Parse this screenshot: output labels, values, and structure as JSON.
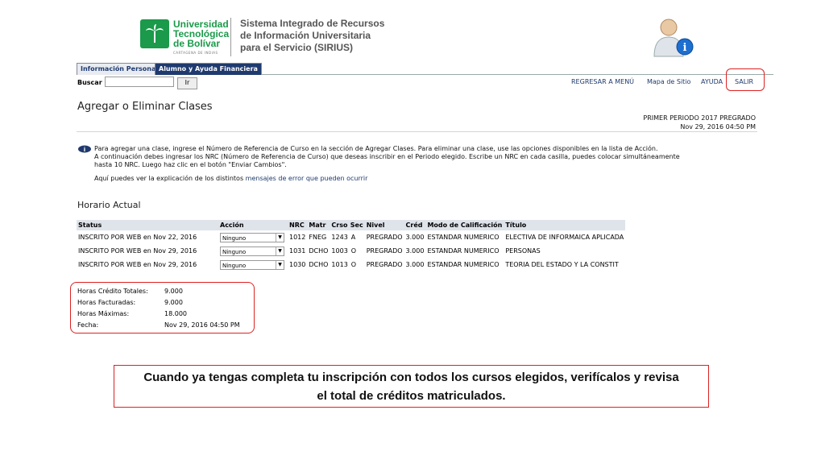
{
  "header": {
    "logo_lines": [
      "Universidad",
      "Tecnológica",
      "de Bolívar"
    ],
    "logo_sub": "CARTAGENA DE INDIAS",
    "system_title_lines": [
      "Sistema Integrado de Recursos",
      "de Información Universitaria",
      "para el Servicio (SIRIUS)"
    ]
  },
  "tabs": [
    {
      "label": "Información Personal"
    },
    {
      "label": "Alumno y Ayuda Financiera"
    }
  ],
  "search": {
    "label": "Buscar",
    "value": "",
    "button": "Ir"
  },
  "toplinks": {
    "menu": "REGRESAR A MENÚ",
    "sitemap": "Mapa de Sitio",
    "help": "AYUDA",
    "exit": "SALIR"
  },
  "page": {
    "title": "Agregar o Eliminar Clases",
    "term": "PRIMER PERIODO 2017 PREGRADO",
    "datetime": "Nov 29, 2016 04:50 PM"
  },
  "info": {
    "line1": "Para agregar una clase, ingrese el Número de Referencia de Curso en la sección de Agregar Clases. Para eliminar una clase, use las opciones disponibles en la lista de Acción.",
    "line2": "A continuación debes ingresar los NRC (Número de Referencia de Curso) que deseas inscribir en el Periodo elegido. Escribe un NRC en cada casilla, puedes colocar simultáneamente",
    "line3": "hasta 10 NRC. Luego haz clic en el botón \"Enviar Cambios\".",
    "explain_prefix": "Aquí puedes ver la explicación de los distintos",
    "explain_link": "mensajes de error que pueden ocurrir"
  },
  "schedule": {
    "title": "Horario Actual",
    "headers": [
      "Status",
      "Acción",
      "NRC",
      "Matr",
      "Crso",
      "Sec",
      "Nivel",
      "Créd",
      "Modo de Calificación",
      "Título"
    ],
    "rows": [
      {
        "status": "INSCRITO POR WEB en Nov 22, 2016",
        "action": "Ninguno",
        "nrc": "1012",
        "matr": "FNEG",
        "crso": "1243",
        "sec": "A",
        "nivel": "PREGRADO",
        "cred": "3.000",
        "modo": "ESTANDAR NUMERICO",
        "titulo": "ELECTIVA DE INFORMAICA APLICADA"
      },
      {
        "status": "INSCRITO POR WEB en Nov 29, 2016",
        "action": "Ninguno",
        "nrc": "1031",
        "matr": "DCHO",
        "crso": "1003",
        "sec": "O",
        "nivel": "PREGRADO",
        "cred": "3.000",
        "modo": "ESTANDAR NUMERICO",
        "titulo": "PERSONAS"
      },
      {
        "status": "INSCRITO POR WEB en Nov 29, 2016",
        "action": "Ninguno",
        "nrc": "1030",
        "matr": "DCHO",
        "crso": "1013",
        "sec": "O",
        "nivel": "PREGRADO",
        "cred": "3.000",
        "modo": "ESTANDAR NUMERICO",
        "titulo": "TEORIA DEL ESTADO Y LA CONSTIT"
      }
    ]
  },
  "credits": [
    {
      "label": "Horas Crédito Totales:",
      "value": "9.000"
    },
    {
      "label": "Horas Facturadas:",
      "value": "9.000"
    },
    {
      "label": "Horas Máximas:",
      "value": "18.000"
    },
    {
      "label": "Fecha:",
      "value": "Nov 29, 2016 04:50 PM"
    }
  ],
  "note": {
    "line1": "Cuando ya tengas completa tu inscripción con todos los cursos elegidos, verifícalos y revisa",
    "line2": "el total de créditos matriculados."
  },
  "colors": {
    "accent": "#1f3a6e",
    "highlight": "#dd2222",
    "brand": "#1a9a4a"
  }
}
